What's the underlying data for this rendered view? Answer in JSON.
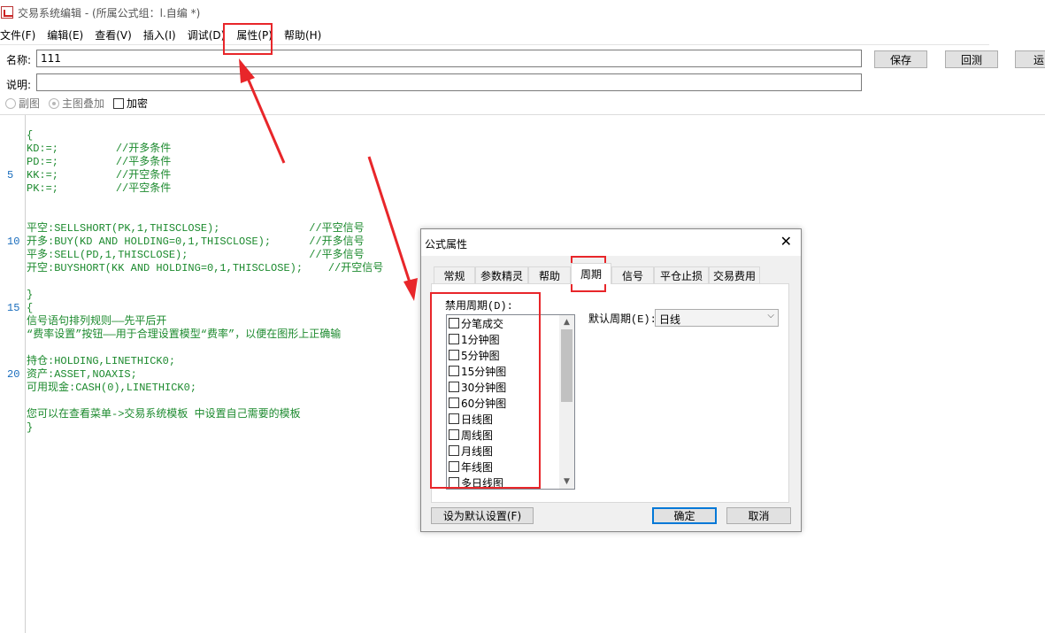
{
  "window": {
    "title": "交易系统编辑 - (所属公式组：l.自编 *)"
  },
  "menu": [
    "文件(F)",
    "编辑(E)",
    "查看(V)",
    "插入(I)",
    "调试(D)",
    "属性(P)",
    "帮助(H)"
  ],
  "form": {
    "name_label": "名称:",
    "name_value": "111",
    "desc_label": "说明:",
    "desc_value": "",
    "buttons": {
      "save": "保存",
      "revert": "回测",
      "run": "运"
    },
    "options": {
      "sub_chart": "副图",
      "main_overlay": "主图叠加",
      "encrypt": "加密"
    }
  },
  "editor": {
    "line_numbers": [
      "5",
      "10",
      "15",
      "20"
    ],
    "lines": [
      "{",
      "KD:=;         //开多条件",
      "PD:=;         //平多条件",
      "KK:=;         //开空条件",
      "PK:=;         //平空条件",
      "",
      "",
      "平空:SELLSHORT(PK,1,THISCLOSE);              //平空信号",
      "开多:BUY(KD AND HOLDING=0,1,THISCLOSE);      //开多信号",
      "平多:SELL(PD,1,THISCLOSE);                   //平多信号",
      "开空:BUYSHORT(KK AND HOLDING=0,1,THISCLOSE);    //开空信号",
      "",
      "}",
      "{",
      "信号语句排列规则——先平后开",
      "“费率设置”按钮——用于合理设置模型“费率”，以便在图形上正确输",
      "",
      "持仓:HOLDING,LINETHICK0;",
      "资产:ASSET,NOAXIS;",
      "可用现金:CASH(0),LINETHICK0;",
      "",
      "您可以在查看菜单->交易系统模板 中设置自己需要的模板",
      "}"
    ]
  },
  "dialog": {
    "title": "公式属性",
    "tabs": [
      "常规",
      "参数精灵",
      "帮助",
      "周期",
      "信号",
      "平仓止损",
      "交易费用"
    ],
    "active_tab": "周期",
    "disabled_period_label": "禁用周期(D):",
    "periods": [
      "分笔成交",
      "1分钟图",
      "5分钟图",
      "15分钟图",
      "30分钟图",
      "60分钟图",
      "日线图",
      "周线图",
      "月线图",
      "年线图",
      "多日线图"
    ],
    "default_period_label": "默认周期(E):",
    "default_period_value": "日线",
    "set_default_button": "设为默认设置(F)",
    "ok_button": "确定",
    "cancel_button": "取消"
  }
}
